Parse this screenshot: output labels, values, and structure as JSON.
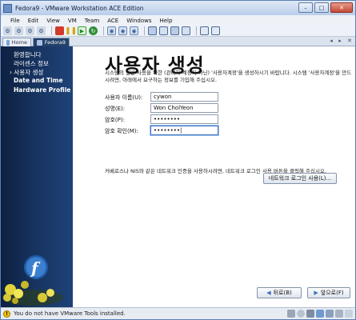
{
  "window": {
    "title": "Fedora9 - VMware Workstation ACE Edition"
  },
  "menubar": [
    "File",
    "Edit",
    "View",
    "VM",
    "Team",
    "ACE",
    "Windows",
    "Help"
  ],
  "tabs": [
    {
      "label": "Home"
    },
    {
      "label": "Fedora9"
    }
  ],
  "sidebar": {
    "items": [
      {
        "label": "환영합니다"
      },
      {
        "label": "라이센스 정보"
      },
      {
        "label": "사용자 생성",
        "marker": "›"
      },
      {
        "label": "Date and Time"
      },
      {
        "label": "Hardware Profile"
      }
    ]
  },
  "content": {
    "heading": "사용자 생성",
    "description": "시스템의 일반 사용을 위한 (관리자 계정이 아닌) '사용자계정'을 생성하시기 바랍니다. 시스템 '사용자계정'을 만드시려면, 아래에서 요구하는 정보를 기입해 주십시오.",
    "fields": [
      {
        "label": "사용자 이름(U):",
        "value": "cywon"
      },
      {
        "label": "성명(E):",
        "value": "Won CholYeon"
      },
      {
        "label": "암호(P):",
        "value": "••••••••"
      },
      {
        "label": "암호 확인(M):",
        "value": "••••••••|"
      }
    ],
    "note": "커베로스나 NIS와 같은 네트워크 인증을 사용하시려면, 네트워크 로그인 사용 버튼을 클릭해 주십시오.",
    "network_button": "네트워크 로그인 사용(L)...",
    "back_button": "뒤로(B)",
    "forward_button": "앞으로(F)"
  },
  "status": {
    "text": "You do not have VMware Tools installed."
  },
  "colors": {
    "sidebar": "#183664",
    "accent": "#3b72c4",
    "close": "#c34a33"
  }
}
